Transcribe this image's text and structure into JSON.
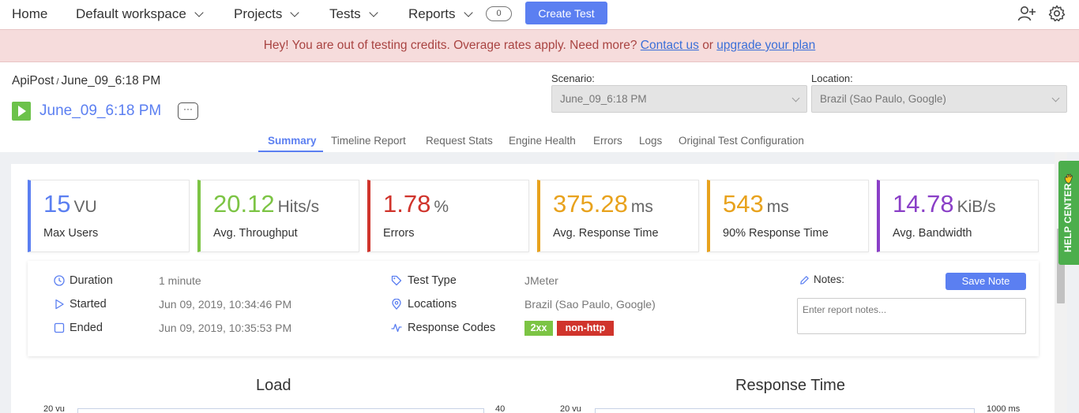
{
  "nav": {
    "home": "Home",
    "workspace": "Default workspace",
    "projects": "Projects",
    "tests": "Tests",
    "reports": "Reports",
    "reports_count": "0",
    "create_test": "Create Test",
    "icons": [
      "add-user-icon",
      "gear-icon"
    ]
  },
  "banner": {
    "message": "Hey! You are out of testing credits. Overage rates apply. Need more?",
    "contact_link": "Contact us",
    "or": "or",
    "upgrade_link": "upgrade your plan"
  },
  "header": {
    "project": "ApiPost",
    "separator": "/",
    "report_name": "June_09_6:18 PM",
    "title": "June_09_6:18 PM",
    "more": "···",
    "scenario_label": "Scenario:",
    "scenario_value": "June_09_6:18 PM",
    "location_label": "Location:",
    "location_value": "Brazil (Sao Paulo, Google)"
  },
  "tabs": [
    {
      "label": "Summary",
      "active": true
    },
    {
      "label": "Timeline Report"
    },
    {
      "label": "Request Stats"
    },
    {
      "label": "Engine Health"
    },
    {
      "label": "Errors"
    },
    {
      "label": "Logs"
    },
    {
      "label": "Original Test Configuration"
    }
  ],
  "kpis": [
    {
      "value": "15",
      "unit": "VU",
      "label": "Max Users",
      "color": "#5b7ff1"
    },
    {
      "value": "20.12",
      "unit": "Hits/s",
      "label": "Avg. Throughput",
      "color": "#7cc444"
    },
    {
      "value": "1.78",
      "unit": "%",
      "label": "Errors",
      "color": "#d0342c"
    },
    {
      "value": "375.28",
      "unit": "ms",
      "label": "Avg. Response Time",
      "color": "#e8a21d"
    },
    {
      "value": "543",
      "unit": "ms",
      "label": "90% Response Time",
      "color": "#e8a21d"
    },
    {
      "value": "14.78",
      "unit": "KiB/s",
      "label": "Avg. Bandwidth",
      "color": "#8a3fc7"
    }
  ],
  "details": {
    "duration_label": "Duration",
    "duration_value": "1 minute",
    "started_label": "Started",
    "started_value": "Jun 09, 2019, 10:34:46 PM",
    "ended_label": "Ended",
    "ended_value": "Jun 09, 2019, 10:35:53 PM",
    "test_type_label": "Test Type",
    "test_type_value": "JMeter",
    "locations_label": "Locations",
    "locations_value": "Brazil (Sao Paulo, Google)",
    "response_codes_label": "Response Codes",
    "response_codes": [
      {
        "label": "2xx",
        "color": "#7cc444"
      },
      {
        "label": "non-http",
        "color": "#d0342c"
      }
    ],
    "notes_label": "Notes:",
    "save_note": "Save Note",
    "notes_placeholder": "Enter report notes..."
  },
  "charts": {
    "load_title": "Load",
    "load_left_axis": "20 vu",
    "load_right_axis": "40",
    "response_title": "Response Time",
    "response_left_axis": "20 vu",
    "response_right_axis": "1000 ms"
  },
  "help": {
    "label": "HELP CENTER"
  }
}
